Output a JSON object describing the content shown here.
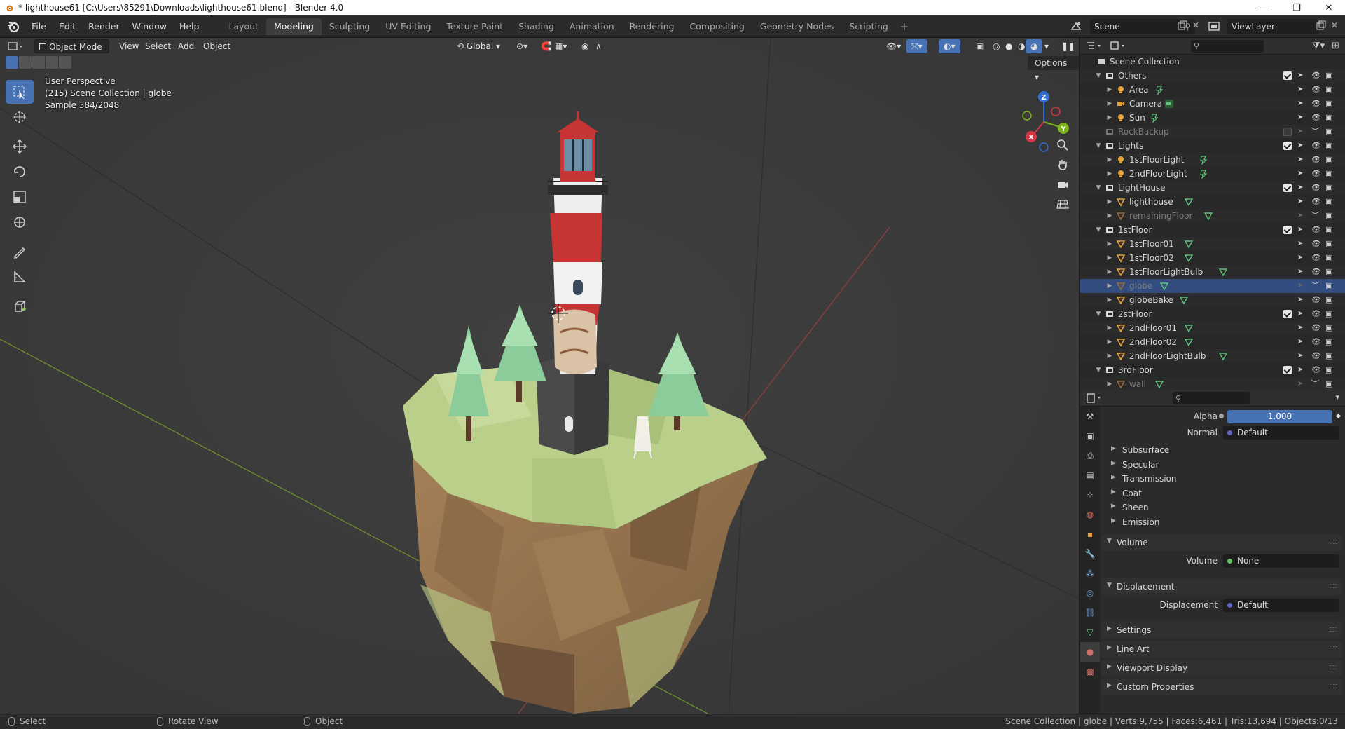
{
  "titlebar": {
    "title": "* lighthouse61 [C:\\Users\\85291\\Downloads\\lighthouse61.blend] - Blender 4.0",
    "minimize": "—",
    "maximize": "❐",
    "close": "✕"
  },
  "menu": [
    "File",
    "Edit",
    "Render",
    "Window",
    "Help"
  ],
  "workspaces": [
    "Layout",
    "Modeling",
    "Sculpting",
    "UV Editing",
    "Texture Paint",
    "Shading",
    "Animation",
    "Rendering",
    "Compositing",
    "Geometry Nodes",
    "Scripting"
  ],
  "active_workspace": "Modeling",
  "scene": {
    "name": "Scene",
    "view_layer": "ViewLayer"
  },
  "viewport": {
    "mode": "Object Mode",
    "menus": [
      "View",
      "Select",
      "Add",
      "Object"
    ],
    "transform": "Global",
    "options": "Options",
    "info": {
      "line1": "User Perspective",
      "line2": "(215) Scene Collection | globe",
      "line3": "Sample 384/2048"
    },
    "gizmo": {
      "x": "X",
      "y": "Y",
      "z": "Z"
    }
  },
  "outliner": {
    "root": "Scene Collection",
    "rows": [
      {
        "label": "Others",
        "kind": "collection",
        "level": 1,
        "expanded": true,
        "check": true
      },
      {
        "label": "Area",
        "kind": "light",
        "level": 2
      },
      {
        "label": "Camera",
        "kind": "camera",
        "level": 2
      },
      {
        "label": "Sun",
        "kind": "light",
        "level": 2
      },
      {
        "label": "RockBackup",
        "kind": "collection",
        "level": 1,
        "dim": true,
        "check": false
      },
      {
        "label": "Lights",
        "kind": "collection",
        "level": 1,
        "expanded": true,
        "check": true
      },
      {
        "label": "1stFloorLight",
        "kind": "light",
        "level": 2
      },
      {
        "label": "2ndFloorLight",
        "kind": "light",
        "level": 2
      },
      {
        "label": "LightHouse",
        "kind": "collection",
        "level": 1,
        "expanded": true,
        "check": true
      },
      {
        "label": "lighthouse",
        "kind": "mesh",
        "level": 2
      },
      {
        "label": "remainingFloor",
        "kind": "mesh",
        "level": 2,
        "dim": true
      },
      {
        "label": "1stFloor",
        "kind": "collection",
        "level": 1,
        "expanded": true,
        "check": true
      },
      {
        "label": "1stFloor01",
        "kind": "mesh",
        "level": 2
      },
      {
        "label": "1stFloor02",
        "kind": "mesh",
        "level": 2
      },
      {
        "label": "1stFloorLightBulb",
        "kind": "mesh",
        "level": 2
      },
      {
        "label": "globe",
        "kind": "mesh",
        "level": 2,
        "dim": true,
        "selected": true
      },
      {
        "label": "globeBake",
        "kind": "mesh",
        "level": 2
      },
      {
        "label": "2stFloor",
        "kind": "collection",
        "level": 1,
        "expanded": true,
        "check": true
      },
      {
        "label": "2ndFloor01",
        "kind": "mesh",
        "level": 2
      },
      {
        "label": "2ndFloor02",
        "kind": "mesh",
        "level": 2
      },
      {
        "label": "2ndFloorLightBulb",
        "kind": "mesh",
        "level": 2
      },
      {
        "label": "3rdFloor",
        "kind": "collection",
        "level": 1,
        "expanded": true,
        "check": true
      },
      {
        "label": "wall",
        "kind": "mesh",
        "level": 2,
        "dim": true
      }
    ]
  },
  "properties": {
    "alpha_label": "Alpha",
    "alpha_value": "1.000",
    "normal_label": "Normal",
    "normal_value": "Default",
    "subpanels": [
      "Subsurface",
      "Specular",
      "Transmission",
      "Coat",
      "Sheen",
      "Emission"
    ],
    "volume_panel": "Volume",
    "volume_label": "Volume",
    "volume_value": "None",
    "displacement_panel": "Displacement",
    "displacement_label": "Displacement",
    "displacement_value": "Default",
    "closed_panels": [
      "Settings",
      "Line Art",
      "Viewport Display",
      "Custom Properties"
    ]
  },
  "statusbar": {
    "select": "Select",
    "rotate": "Rotate View",
    "object": "Object",
    "stats": "Scene Collection | globe | Verts:9,755 | Faces:6,461 | Tris:13,694 | Objects:0/13"
  },
  "colors": {
    "accent": "#4772b3",
    "selected_row": "#334d80",
    "viewport_bg": "#3b3b3b",
    "grass": "#b9cf8a",
    "rock": "#9e7a53",
    "lighthouse_red": "#c73434",
    "tree": "#8ccc9a"
  }
}
